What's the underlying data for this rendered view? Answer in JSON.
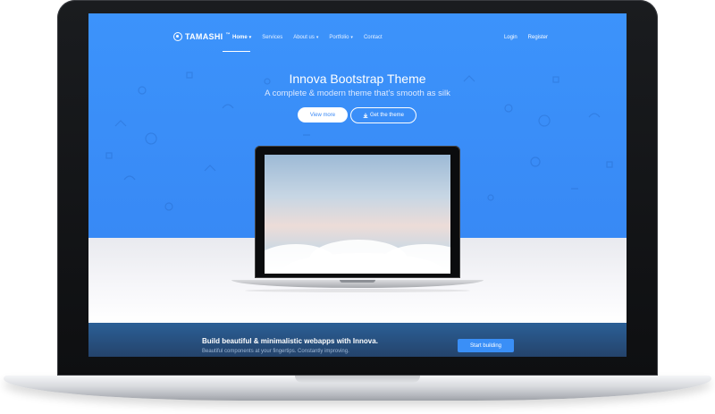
{
  "nav": {
    "logo": "TAMASHI",
    "logo_tm": "™",
    "items": [
      {
        "label": "Home",
        "caret": true,
        "active": true
      },
      {
        "label": "Services",
        "caret": false,
        "active": false
      },
      {
        "label": "About us",
        "caret": true,
        "active": false
      },
      {
        "label": "Portfolio",
        "caret": true,
        "active": false
      },
      {
        "label": "Contact",
        "caret": false,
        "active": false
      }
    ],
    "login": "Login",
    "register": "Register"
  },
  "hero": {
    "title": "Innova Bootstrap Theme",
    "subtitle": "A complete & modern theme that's smooth as silk",
    "primary_button": "View more",
    "secondary_button": "Get the theme",
    "secondary_icon": "download-icon"
  },
  "band": {
    "title": "Build beautiful & minimalistic webapps with Innova.",
    "subtitle": "Beautiful components at your fingertips. Constantly improving.",
    "button": "Start building"
  },
  "colors": {
    "hero_blue": "#3a8ff7",
    "band_dark": "#24436b",
    "white": "#ffffff"
  }
}
